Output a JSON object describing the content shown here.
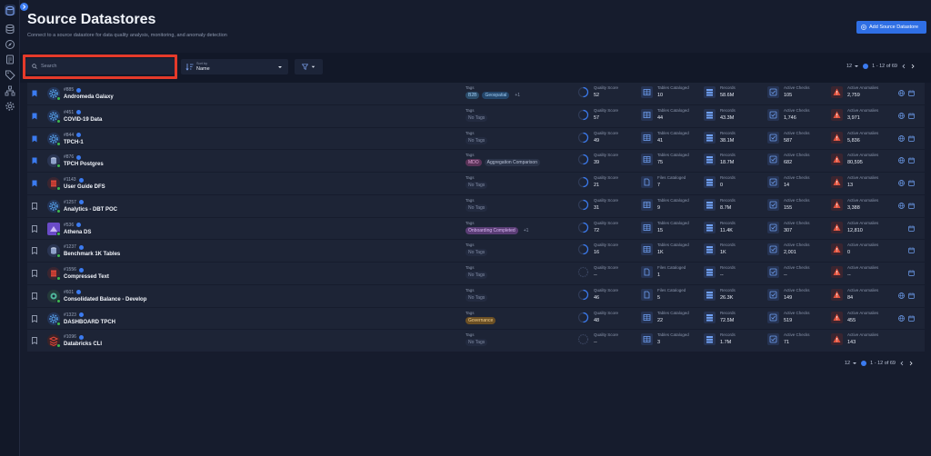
{
  "header": {
    "title": "Source Datastores",
    "subtitle": "Connect to a source datastore for data quality analysis, monitoring, and anomaly detection",
    "add_button": "Add Source Datastore"
  },
  "toolbar": {
    "search_placeholder": "Search",
    "sort_label": "Sort by",
    "sort_value": "Name"
  },
  "pagination": {
    "page_size": "12",
    "range": "1 - 12 of 69"
  },
  "labels": {
    "tags": "Tags",
    "quality": "Quality Score",
    "records": "Records",
    "active_checks": "Active Checks",
    "active_anomalies": "Active Anomalies"
  },
  "colors": {
    "accent": "#2f6fe5",
    "highlight": "#e53a2a",
    "status_online": "#3fb950",
    "anomaly": "#e2543f"
  },
  "rows": [
    {
      "id": "#885",
      "name": "Andromeda Galaxy",
      "bookmarked": true,
      "icon": "gear-icon",
      "tags": [
        {
          "text": "B2B",
          "kind": "b2b"
        },
        {
          "text": "Geospatial",
          "kind": "geo"
        },
        {
          "text": "+1",
          "kind": "more"
        }
      ],
      "quality": "52",
      "cat_label": "Tables Cataloged",
      "cat": "10",
      "records": "58.6M",
      "checks": "105",
      "anomalies": "2,759",
      "actions": 2
    },
    {
      "id": "#451",
      "name": "COVID-19 Data",
      "bookmarked": true,
      "icon": "gear-icon",
      "tags": [
        {
          "text": "No Tags",
          "kind": "none"
        }
      ],
      "quality": "57",
      "cat_label": "Tables Cataloged",
      "cat": "44",
      "records": "43.3M",
      "checks": "1,746",
      "anomalies": "3,971",
      "actions": 2
    },
    {
      "id": "#844",
      "name": "TPCH-1",
      "bookmarked": true,
      "icon": "gear-icon",
      "tags": [
        {
          "text": "No Tags",
          "kind": "none"
        }
      ],
      "quality": "49",
      "cat_label": "Tables Cataloged",
      "cat": "41",
      "records": "38.1M",
      "checks": "587",
      "anomalies": "5,836",
      "actions": 2
    },
    {
      "id": "#876",
      "name": "TPCH Postgres",
      "bookmarked": true,
      "icon": "db-icon",
      "tags": [
        {
          "text": "MDO",
          "kind": "mdo"
        },
        {
          "text": "Aggregation Comparison",
          "kind": "agg"
        }
      ],
      "quality": "39",
      "cat_label": "Tables Cataloged",
      "cat": "75",
      "records": "18.7M",
      "checks": "682",
      "anomalies": "80,595",
      "actions": 2
    },
    {
      "id": "#1143",
      "name": "User Guide DFS",
      "bookmarked": true,
      "icon": "dfs-icon",
      "tags": [
        {
          "text": "No Tags",
          "kind": "none"
        }
      ],
      "quality": "21",
      "cat_label": "Files Cataloged",
      "cat": "7",
      "records": "0",
      "checks": "14",
      "anomalies": "13",
      "actions": 2
    },
    {
      "id": "#1257",
      "name": "Analytics - DBT POC",
      "bookmarked": false,
      "icon": "gear-icon",
      "tags": [
        {
          "text": "No Tags",
          "kind": "none"
        }
      ],
      "quality": "31",
      "cat_label": "Tables Cataloged",
      "cat": "9",
      "records": "8.7M",
      "checks": "155",
      "anomalies": "3,388",
      "actions": 2
    },
    {
      "id": "#536",
      "name": "Athena DS",
      "bookmarked": false,
      "icon": "athena-icon",
      "tags": [
        {
          "text": "Onboarding Completed",
          "kind": "onb"
        },
        {
          "text": "+1",
          "kind": "more"
        }
      ],
      "quality": "72",
      "cat_label": "Tables Cataloged",
      "cat": "15",
      "records": "11.4K",
      "checks": "307",
      "anomalies": "12,810",
      "actions": 1
    },
    {
      "id": "#1237",
      "name": "Benchmark 1K Tables",
      "bookmarked": false,
      "icon": "db-icon",
      "tags": [
        {
          "text": "No Tags",
          "kind": "none"
        }
      ],
      "quality": "16",
      "cat_label": "Tables Cataloged",
      "cat": "1K",
      "records": "1K",
      "checks": "2,001",
      "anomalies": "0",
      "actions": 1
    },
    {
      "id": "#1556",
      "name": "Compressed Text",
      "bookmarked": false,
      "icon": "dfs-icon",
      "tags": [
        {
          "text": "No Tags",
          "kind": "none"
        }
      ],
      "quality": "--",
      "cat_label": "Files Cataloged",
      "cat": "1",
      "records": "--",
      "checks": "--",
      "anomalies": "--",
      "actions": 1
    },
    {
      "id": "#601",
      "name": "Consolidated Balance - Develop",
      "bookmarked": false,
      "icon": "balance-icon",
      "tags": [
        {
          "text": "No Tags",
          "kind": "none"
        }
      ],
      "quality": "46",
      "cat_label": "Files Cataloged",
      "cat": "5",
      "records": "26.3K",
      "checks": "149",
      "anomalies": "84",
      "actions": 2
    },
    {
      "id": "#1323",
      "name": "DASHBOARD TPCH",
      "bookmarked": false,
      "icon": "gear-icon",
      "tags": [
        {
          "text": "Governance",
          "kind": "gov"
        }
      ],
      "quality": "48",
      "cat_label": "Tables Cataloged",
      "cat": "22",
      "records": "72.5M",
      "checks": "519",
      "anomalies": "455",
      "actions": 2
    },
    {
      "id": "#1096",
      "name": "Databricks CLI",
      "bookmarked": false,
      "icon": "databricks-icon",
      "tags": [
        {
          "text": "No Tags",
          "kind": "none"
        }
      ],
      "quality": "--",
      "cat_label": "Tables Cataloged",
      "cat": "3",
      "records": "1.7M",
      "checks": "71",
      "anomalies": "143",
      "actions": 0
    }
  ]
}
